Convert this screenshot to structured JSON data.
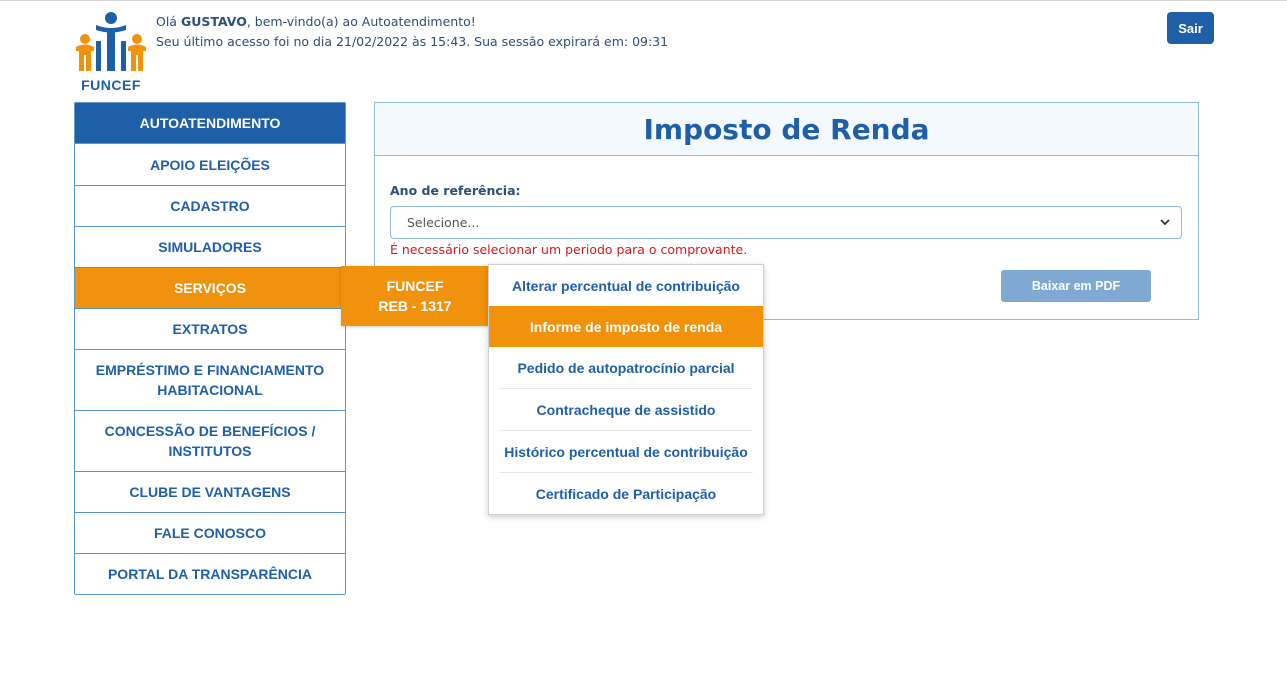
{
  "header": {
    "logo_text": "FUNCEF",
    "greeting_prefix": "Olá ",
    "user_name": "GUSTAVO",
    "greeting_suffix": ", bem-vindo(a) ao Autoatendimento!",
    "last_access": "Seu último acesso foi no dia 21/02/2022 às 15:43. Sua sessão expirará em: 09:31",
    "logout_label": "Sair"
  },
  "sidebar": {
    "title": "AUTOATENDIMENTO",
    "items": [
      {
        "label": "APOIO ELEIÇÕES"
      },
      {
        "label": "CADASTRO"
      },
      {
        "label": "SIMULADORES"
      },
      {
        "label": "SERVIÇOS"
      },
      {
        "label": "EXTRATOS"
      },
      {
        "label": "EMPRÉSTIMO E FINANCIAMENTO HABITACIONAL"
      },
      {
        "label": "CONCESSÃO DE BENEFÍCIOS / INSTITUTOS"
      },
      {
        "label": "CLUBE DE VANTAGENS"
      },
      {
        "label": "FALE CONOSCO"
      },
      {
        "label": "PORTAL DA TRANSPARÊNCIA"
      }
    ],
    "active_index": 3
  },
  "submenu_plan": {
    "line1": "FUNCEF",
    "line2": "REB - 1317"
  },
  "submenu_services": {
    "items": [
      {
        "label": "Alterar percentual de contribuição"
      },
      {
        "label": "Informe de imposto de renda"
      },
      {
        "label": "Pedido de autopatrocínio parcial"
      },
      {
        "label": "Contracheque de assistido"
      },
      {
        "label": "Histórico percentual de contribuição"
      },
      {
        "label": "Certificado de Participação"
      }
    ],
    "active_index": 1
  },
  "main": {
    "title": "Imposto de Renda",
    "field_label": "Ano de referência:",
    "select_value": "Selecione...",
    "error_text": "É necessário selecionar um periodo para o comprovante.",
    "download_label": "Baixar em PDF"
  },
  "colors": {
    "primary": "#1f5fa8",
    "accent": "#f0920c",
    "error": "#d0191f",
    "disabled_button": "#7fa9d3"
  }
}
